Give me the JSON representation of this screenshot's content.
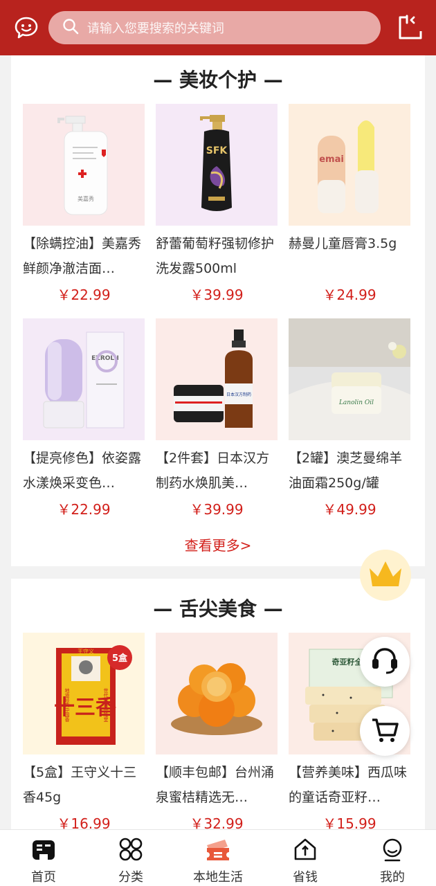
{
  "search": {
    "placeholder": "请输入您要搜索的关键词"
  },
  "sections": [
    {
      "title": "— 美妆个护 —",
      "more": "查看更多>",
      "products": [
        {
          "name": "【除螨控油】美嘉秀鲜颜净澈洁面…",
          "price": "￥22.99"
        },
        {
          "name": "舒蕾葡萄籽强韧修护洗发露500ml",
          "price": "￥39.99"
        },
        {
          "name": "赫曼儿童唇膏3.5g",
          "price": "￥24.99"
        },
        {
          "name": "【提亮修色】依姿露水漾焕采变色…",
          "price": "￥22.99"
        },
        {
          "name": "【2件套】日本汉方制药水焕肌美…",
          "price": "￥39.99"
        },
        {
          "name": "【2罐】澳芝曼绵羊油面霜250g/罐",
          "price": "￥49.99"
        }
      ]
    },
    {
      "title": "— 舌尖美食 —",
      "products": [
        {
          "name": "【5盒】王守义十三香45g",
          "price": "￥16.99"
        },
        {
          "name": "【顺丰包邮】台州涌泉蜜桔精选无…",
          "price": "￥32.99"
        },
        {
          "name": "【营养美味】西瓜味的童话奇亚籽…",
          "price": "￥15.99"
        }
      ]
    }
  ],
  "product_images": {
    "p0": {
      "brand": "美嘉秀"
    },
    "p1": {
      "brand": "SFK"
    },
    "p2": {
      "brand": "emai"
    },
    "p3": {
      "brand": "EZROLII"
    },
    "p4": {
      "label": "日本汉方制药"
    },
    "p5": {
      "label": "Lanolin Oil"
    },
    "f0": {
      "badge": "5盒",
      "brand": "王守义",
      "big": "十三香",
      "left": "地道经典中国香",
      "right": "世代传承兴隆堂"
    },
    "f2": {
      "brand": "奇亚籽全麦"
    }
  },
  "tabs": [
    {
      "label": "首页",
      "icon": "home-icon"
    },
    {
      "label": "分类",
      "icon": "category-icon"
    },
    {
      "label": "本地生活",
      "icon": "ticket-icon"
    },
    {
      "label": "省钱",
      "icon": "save-money-icon"
    },
    {
      "label": "我的",
      "icon": "profile-icon"
    }
  ],
  "colors": {
    "brand_red": "#b8231e",
    "price_red": "#d21f1a"
  }
}
